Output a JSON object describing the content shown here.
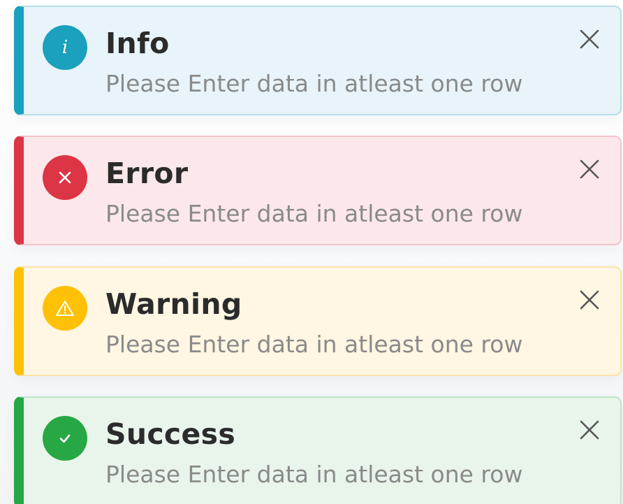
{
  "toasts": [
    {
      "type": "info",
      "title": "Info",
      "message": "Please Enter data in atleast one row",
      "icon": "info-icon",
      "accent": "#1ba0bd"
    },
    {
      "type": "error",
      "title": "Error",
      "message": "Please Enter data in atleast one row",
      "icon": "error-x-icon",
      "accent": "#dc3545"
    },
    {
      "type": "warning",
      "title": "Warning",
      "message": "Please Enter data in atleast one row",
      "icon": "warning-icon",
      "accent": "#fec107"
    },
    {
      "type": "success",
      "title": "Success",
      "message": "Please Enter data in atleast one row",
      "icon": "check-icon",
      "accent": "#28a745"
    }
  ],
  "close_icon": "close-icon"
}
